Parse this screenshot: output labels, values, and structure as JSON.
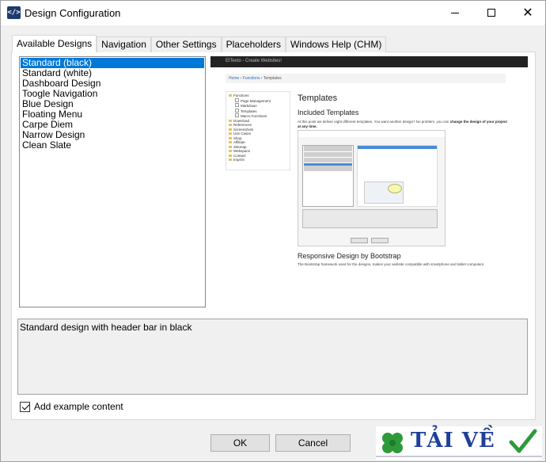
{
  "window": {
    "title": "Design Configuration",
    "icon_name": "code-brackets-icon",
    "icon_glyph": "</>"
  },
  "tabs": [
    {
      "label": "Available Designs",
      "active": true
    },
    {
      "label": "Navigation",
      "active": false
    },
    {
      "label": "Other Settings",
      "active": false
    },
    {
      "label": "Placeholders",
      "active": false
    },
    {
      "label": "Windows Help (CHM)",
      "active": false
    }
  ],
  "designs": {
    "selected_index": 0,
    "items": [
      "Standard (black)",
      "Standard (white)",
      "Dashboard Design",
      "Toogle Navigation",
      "Blue Design",
      "Floating Menu",
      "Carpe Diem",
      "Narrow Design",
      "Clean Slate"
    ]
  },
  "preview": {
    "header": "ElTexto - Create Websites!",
    "breadcrumb": [
      "Home",
      "Functions",
      "Templates"
    ],
    "nav": [
      {
        "label": "Functions",
        "sub": false
      },
      {
        "label": "Page Management",
        "sub": true
      },
      {
        "label": "Markdown",
        "sub": true
      },
      {
        "label": "Templates",
        "sub": true
      },
      {
        "label": "Macro Functions",
        "sub": true
      },
      {
        "label": "Download",
        "sub": false
      },
      {
        "label": "References",
        "sub": false
      },
      {
        "label": "Screenshots",
        "sub": false
      },
      {
        "label": "Use Cases",
        "sub": false
      },
      {
        "label": "Shop",
        "sub": false
      },
      {
        "label": "Affiliate",
        "sub": false
      },
      {
        "label": "Sitemap",
        "sub": false
      },
      {
        "label": "Webspace",
        "sub": false
      },
      {
        "label": "Contact",
        "sub": false
      },
      {
        "label": "Imprint",
        "sub": false
      }
    ],
    "heading": "Templates",
    "subheading": "Included Templates",
    "intro": "At this point we deliver eight different templates. You want another design? No problem, you can",
    "intro_bold": "change the design of your project at any time.",
    "heading2": "Responsive Design by Bootstrap",
    "text2": "The Bootstrap framework used for the designs, makes your website compatible with smartphone and tablet computers."
  },
  "description": "Standard design with header bar in black",
  "add_example": {
    "label": "Add example content",
    "checked": true
  },
  "buttons": {
    "ok": "OK",
    "cancel": "Cancel"
  },
  "watermark": {
    "text": "TẢI VỀ",
    "colors": {
      "text": "#1e3f9a",
      "clover": "#2e9a3a",
      "check": "#2e9a3a"
    }
  }
}
